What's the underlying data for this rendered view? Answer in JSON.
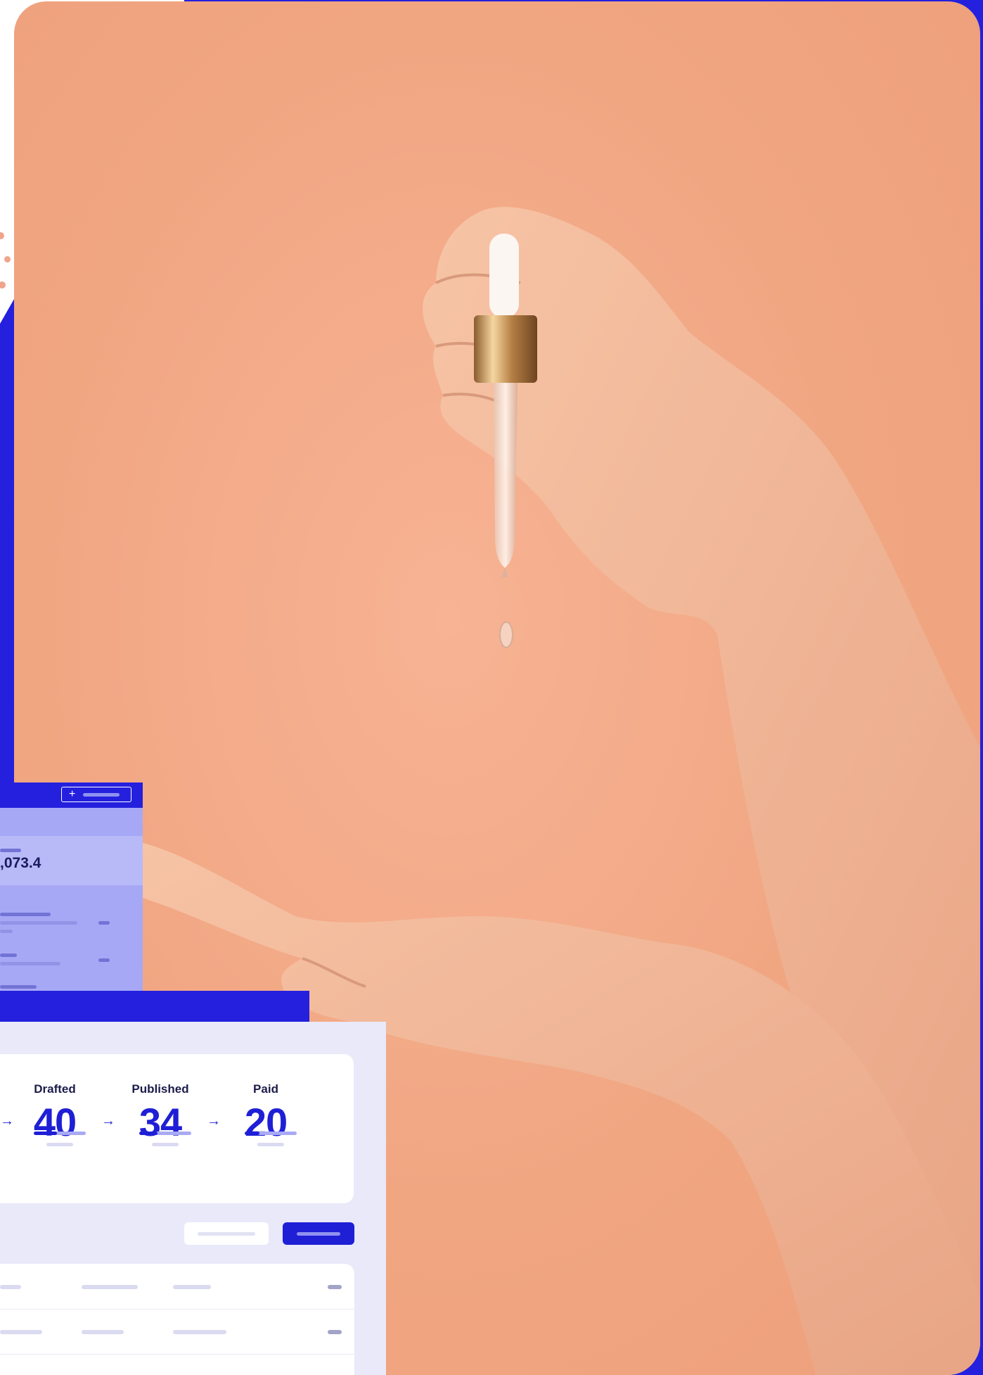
{
  "colors": {
    "brand_blue": "#2420de",
    "accent_blue": "#1f1fd6",
    "photo_peach": "#f1a682",
    "panel_lavender": "#e9e9fa"
  },
  "photo": {
    "subject": "hand-dripping-serum-dropper-icon"
  },
  "back_panel": {
    "add_button_icon": "plus-icon",
    "add_button_symbol": "+",
    "amount": ",073.4"
  },
  "pipeline": {
    "stages": [
      {
        "label": "Drafted",
        "value": "40",
        "progress": 0.45
      },
      {
        "label": "Published",
        "value": "34",
        "progress": 0.35
      },
      {
        "label": "Paid",
        "value": "20",
        "progress": 0.28
      }
    ],
    "arrow_symbol": "→"
  }
}
